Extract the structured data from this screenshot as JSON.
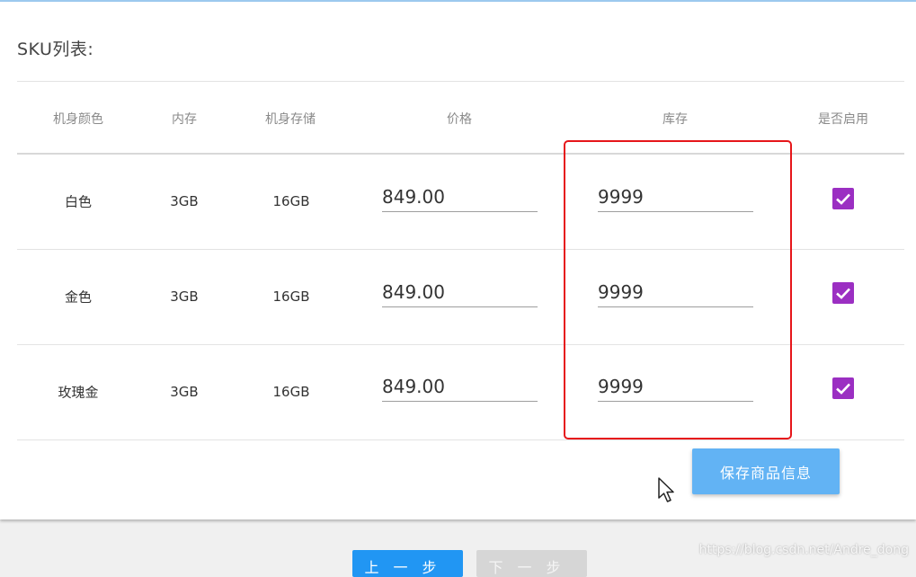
{
  "section_title": "SKU列表:",
  "table": {
    "headers": [
      "机身颜色",
      "内存",
      "机身存储",
      "价格",
      "库存",
      "是否启用"
    ],
    "rows": [
      {
        "color": "白色",
        "memory": "3GB",
        "storage": "16GB",
        "price": "849.00",
        "stock": "9999",
        "enabled": true
      },
      {
        "color": "金色",
        "memory": "3GB",
        "storage": "16GB",
        "price": "849.00",
        "stock": "9999",
        "enabled": true
      },
      {
        "color": "玫瑰金",
        "memory": "3GB",
        "storage": "16GB",
        "price": "849.00",
        "stock": "9999",
        "enabled": true
      }
    ]
  },
  "save_button_label": "保存商品信息",
  "footer": {
    "prev_label": "上一步",
    "next_label": "下一步"
  },
  "watermark": "https://blog.csdn.net/Andre_dong",
  "colors": {
    "checkbox": "#9b2fc2",
    "highlight": "#e6161a",
    "save_button": "#62b3f4",
    "primary_button": "#2196f3"
  },
  "icons": [
    "checkbox-checked-icon",
    "mouse-cursor-icon"
  ]
}
